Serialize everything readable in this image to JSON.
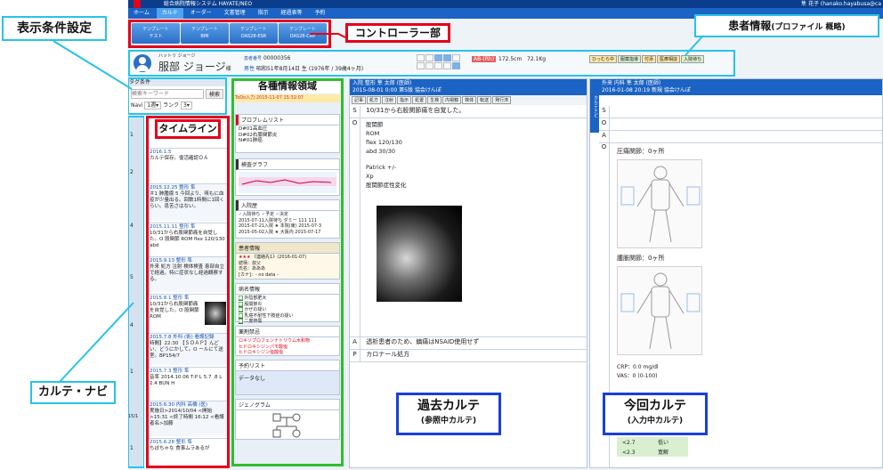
{
  "app": {
    "title": "総合病院情報システム HAYATE/NEO",
    "user": "隼 花子 (hanako.hayabusa@ca",
    "menu": [
      "ホーム",
      "カルテ",
      "オーダー",
      "文書管理",
      "指示",
      "経過表等",
      "予約"
    ]
  },
  "templates": [
    {
      "line1": "テンプレート",
      "line2": "テスト"
    },
    {
      "line1": "テンプレート",
      "line2": "BMI"
    },
    {
      "line1": "テンプレート",
      "line2": "DAS28-ESR"
    },
    {
      "line1": "テンプレート",
      "line2": "DAS28-CRP"
    }
  ],
  "callouts": {
    "display_settings": "表示条件設定",
    "controller": "コントローラー部",
    "patient_info": "患者情報",
    "patient_info_sub": "(プロファイル 概略)",
    "timeline": "タイムライン",
    "info_area": "各種情報領域",
    "karte_navi": "カルテ・ナビ",
    "past_karte": "過去カルテ",
    "past_karte_sub": "(参照中カルテ)",
    "current_karte": "今回カルテ",
    "current_karte_sub": "(入力中カルテ)"
  },
  "patient": {
    "kana": "ハットリ ジョージ",
    "name": "服部 ジョージ",
    "honorific": "様",
    "id_label": "患者番号",
    "id": "00000356",
    "sex": "男性",
    "birth": "昭和51年8月14日 生 (1976年 / 39歳4ヶ月)",
    "blood": "AB-(Rh)",
    "height": "172.5cm",
    "weight": "72.1Kg",
    "badges": [
      "ひっむら中",
      "服薬指導",
      "付添",
      "医療相談",
      "入院待ち"
    ]
  },
  "search": {
    "tag_label": "タグ条件",
    "placeholder": "検索キーワード",
    "button": "検索",
    "navi": "Navi",
    "period": "1週",
    "rank_label": "ランク",
    "rank": "3"
  },
  "timeline_entries": [
    {
      "date": "2016.1.5",
      "dept": "整形 隼",
      "text": "カルテ保存。復活確認ＯＡ"
    },
    {
      "date": "2015.12.25",
      "dept": "整形 隼",
      "text": "＃1 肺腫瘍 5 今回より、咳もに血疫が少量出る。回数1時間に1回くらい。息苦さはない。"
    },
    {
      "date": "2015.11.11",
      "dept": "整形 隼",
      "text": "10/31から右股関節痛を自覚した。O 股関節 ROM flex 120/130 abd"
    },
    {
      "date": "2015.9.13",
      "dept": "整形 隼",
      "text": "外来 処方 注射 検体検査 患部自立で経過。特に症状なし経過観察する。"
    },
    {
      "date": "2015.8.1",
      "dept": "整形 隼",
      "text": "10/31から右股関節痛を自覚した。O 股関節 ROM"
    },
    {
      "date": "2015.7.8",
      "dept": "外科 (術) 看護記録",
      "text": "時間】22:30 【ＳＯＡＰ】んどい、どうにかして。O ールにて送室。BP154/7"
    },
    {
      "date": "2015.7.3",
      "dept": "整形 隼",
      "text": "音率 2014.10.06 T-P L 5.7 .8 L 2.4 BUN H"
    },
    {
      "date": "2015.6.30",
      "dept": "内科 高橋 (医)",
      "text": "実施日>2014/10/04 <開始>15:31 <終了時間 16:12 <看護者名>加藤"
    },
    {
      "date": "2015.6.28",
      "dept": "整形 隼",
      "text": "ちぼちゃな 食事ムラあるが"
    }
  ],
  "timeline_markers": [
    "1",
    "2",
    "4",
    "5",
    "4",
    "1",
    "15/1",
    "1"
  ],
  "info_panels": {
    "todo": "ToDo入力:2015-11-07 15:32:07",
    "problem_title": "プロブレムリスト",
    "problems": [
      "D#01高血圧",
      "D#02右膝関節炎",
      "N#01肺癌"
    ],
    "graph_title": "検査グラフ",
    "admission_title": "入院歴",
    "admission_legend": [
      "入院待ち",
      "予定",
      "決定"
    ],
    "admissions": [
      "2015-07-11入院待ち ダミー 111 111",
      "2015-07-21入院 ★ 本院(東) 2015-07-3",
      "2015-05-02入院 ★ 大阪内 2015-07-17"
    ],
    "memo_title": "患者情報",
    "memo_stars": "★★★",
    "memo_text": "《連絡先1》(2016-01-07)",
    "memo_lines": [
      "続柄：叔父",
      "氏名：あああ",
      "[カナ]：- no data -"
    ],
    "disease_title": "病名情報",
    "diseases": [
      "外陰部肥大",
      "股関節炎",
      "かぜの疑い",
      "乳癌不耐性下肢症の疑い",
      "二度熱傷"
    ],
    "allergy_title": "薬剤禁忌",
    "allergies": [
      "ロキソプロフェンナトリウム水和物",
      "ヒドロキシジンパモ酸塩",
      "ヒドロキシジン塩酸塩"
    ],
    "reservation_title": "予約リスト",
    "reservation_text": "データなし",
    "genogram_title": "ジェノグラム"
  },
  "past_karte": {
    "header1": "入院 整形 隼 太郎 (医師)",
    "header2": "2015-08-01 0:00 第5版 協会けんぽ",
    "tags": [
      "記事",
      "処方",
      "注射",
      "指示",
      "処置",
      "生検",
      "内視鏡",
      "検体",
      "転送",
      "発行済"
    ],
    "S": "10/31から右股関節痛を自覚した。",
    "O_lines": [
      "股関節",
      "ROM",
      "flex 120/130",
      "abd 30/30",
      "",
      "Patrick +/-",
      "Xp",
      "股関節症性変化"
    ],
    "A": "透析患者のため、鎮痛はNSAID使用せず",
    "P": "カロナール処方"
  },
  "current_karte": {
    "header1": "外来 内科 隼 太郎 (医師)",
    "header2": "2016-01-08 20:19 新規 協会けんぽ",
    "side_tab": "カルテナビ",
    "o_title1": "圧痛関節：0ヶ所",
    "o_title2": "腫脹関節：0ヶ所",
    "crp": "CRP：0.0 mg/dl",
    "vas": "VAS：0 (0-100)",
    "table": [
      {
        "range": "<2.7",
        "label": "低い"
      },
      {
        "range": "<2.3",
        "label": "寛解"
      }
    ]
  },
  "colors": {
    "red": "#e3001b",
    "green": "#2fbd2f",
    "cyan": "#27c3e6",
    "blue": "#1a3fd6",
    "nav_dark": "#0a3e8c"
  }
}
